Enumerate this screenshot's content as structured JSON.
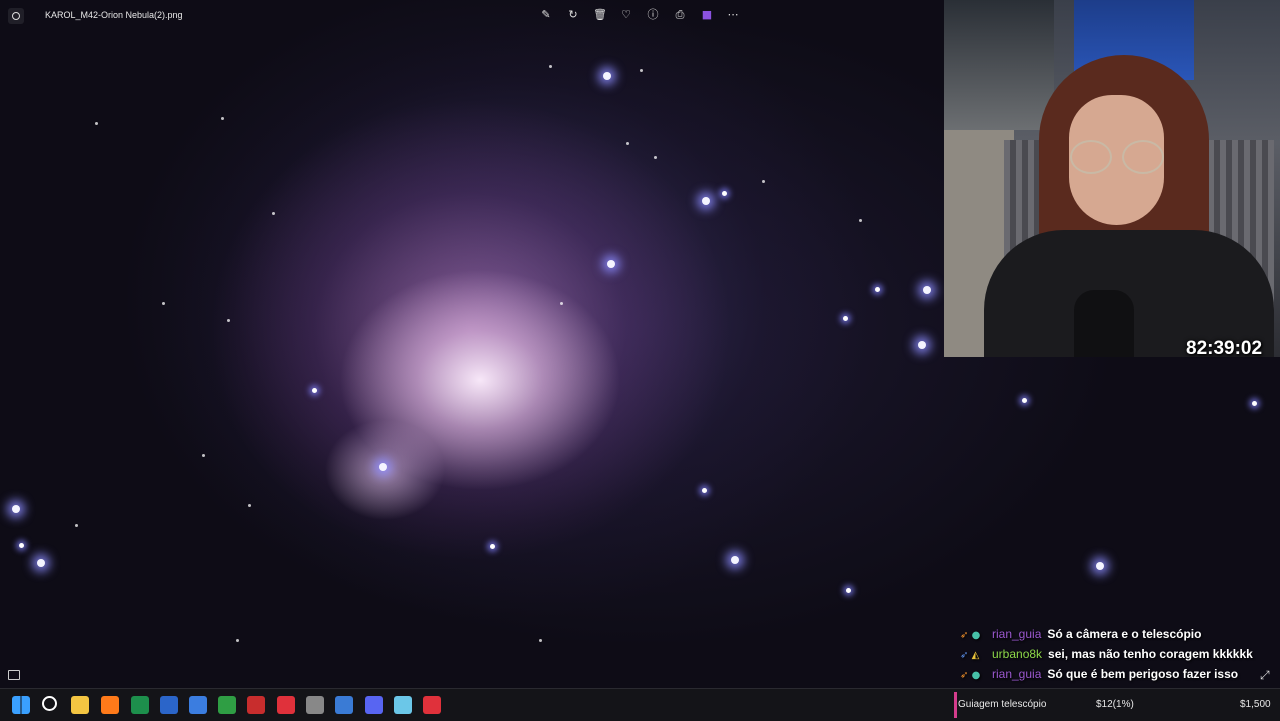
{
  "viewer": {
    "file_title": "KAROL_M42-Orion Nebula(2).png",
    "toolbar": [
      {
        "name": "edit-icon",
        "glyph": "✎"
      },
      {
        "name": "rotate-icon",
        "glyph": "↻"
      },
      {
        "name": "delete-icon",
        "glyph": "🗑"
      },
      {
        "name": "favorite-icon",
        "glyph": "♡"
      },
      {
        "name": "info-icon",
        "glyph": "ⓘ"
      },
      {
        "name": "print-icon",
        "glyph": "⎙"
      },
      {
        "name": "clipchamp-icon",
        "glyph": "■"
      },
      {
        "name": "more-icon",
        "glyph": "⋯"
      }
    ]
  },
  "stream": {
    "timer": "82:39:02"
  },
  "chat": [
    {
      "user": "rian_guia",
      "user_color": "#9b59d0",
      "message": "Só a câmera e o telescópio"
    },
    {
      "user": "urbano8k",
      "user_color": "#8dd84a",
      "message": "sei, mas não tenho coragem kkkkkk"
    },
    {
      "user": "rian_guia",
      "user_color": "#9b59d0",
      "message": "Só que é bem perigoso fazer isso"
    }
  ],
  "goal": {
    "label": "Guiagem telescópio",
    "current": "$12(1%)",
    "target": "$1,500",
    "progress_fraction": 0.01,
    "color": "#d43c8c"
  },
  "taskbar": [
    {
      "name": "start-icon",
      "color": "#3aa0ff"
    },
    {
      "name": "search-icon",
      "color": "#ffffff"
    },
    {
      "name": "file-explorer-icon",
      "color": "#f4c542"
    },
    {
      "name": "firefox-icon",
      "color": "#ff7a1a"
    },
    {
      "name": "excel-icon",
      "color": "#1d8f4c"
    },
    {
      "name": "word-icon",
      "color": "#2b65c9"
    },
    {
      "name": "app-icon",
      "color": "#3b7de0"
    },
    {
      "name": "chrome-icon",
      "color": "#2f9e44"
    },
    {
      "name": "obs-icon",
      "color": "#c82d2d"
    },
    {
      "name": "media-player-icon",
      "color": "#e0313b"
    },
    {
      "name": "app-icon",
      "color": "#888888"
    },
    {
      "name": "photos-icon",
      "color": "#3a7bd5"
    },
    {
      "name": "discord-icon",
      "color": "#5865f2"
    },
    {
      "name": "notepad-icon",
      "color": "#6bc7e8"
    },
    {
      "name": "app-icon",
      "color": "#e0313b"
    }
  ]
}
